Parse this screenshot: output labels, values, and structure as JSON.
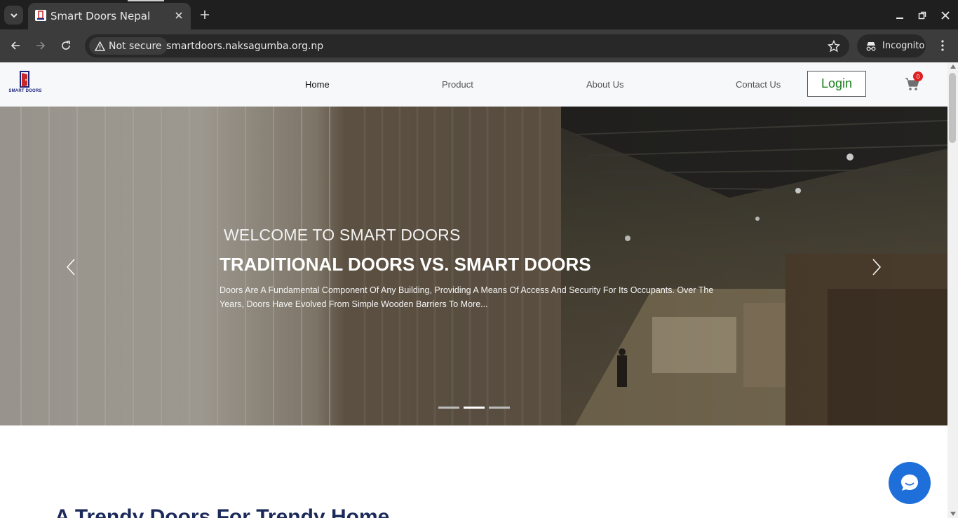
{
  "browser": {
    "tab_title": "Smart Doors Nepal",
    "security_label": "Not secure",
    "url": "smartdoors.naksagumba.org.np",
    "profile_label": "Incognito"
  },
  "site": {
    "logo_text": "SMART DOORS",
    "nav": {
      "home": "Home",
      "product": "Product",
      "about": "About Us",
      "contact": "Contact Us",
      "login": "Login"
    },
    "cart_count": "0"
  },
  "hero": {
    "eyebrow": "WELCOME TO SMART DOORS",
    "title": "TRADITIONAL DOORS VS. SMART DOORS",
    "text": "Doors Are A Fundamental Component Of Any Building, Providing A Means Of Access And Security For Its Occupants. Over The Years, Doors Have Evolved From Simple Wooden Barriers To More...",
    "slides_count": 3,
    "active_slide": 2
  },
  "section": {
    "title": "A Trendy Doors For Trendy Home"
  },
  "colors": {
    "login_text": "#1a7f1a",
    "badge": "#e02020",
    "section_title": "#1b2a5a",
    "chat": "#1e6fd9"
  }
}
